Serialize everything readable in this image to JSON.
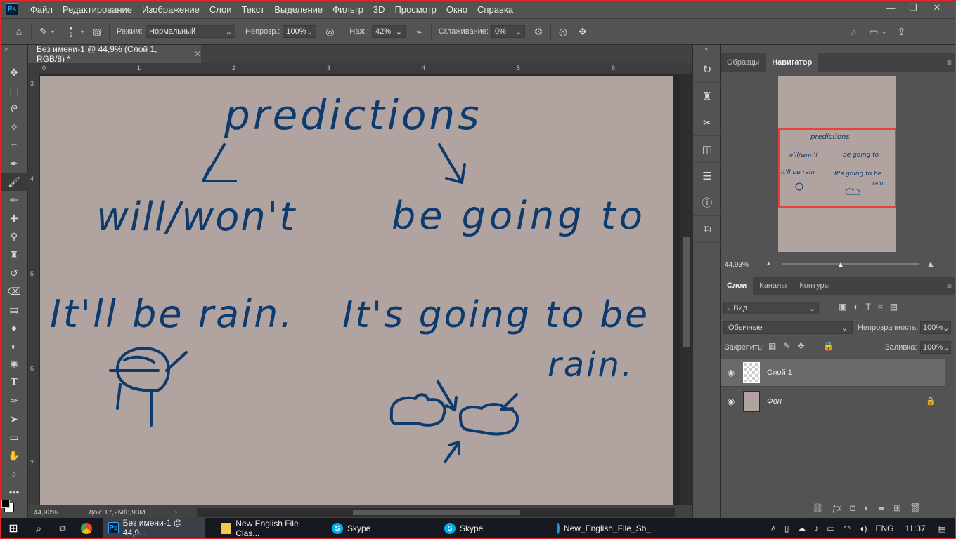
{
  "app": {
    "logo": "Ps",
    "menu": [
      "Файл",
      "Редактирование",
      "Изображение",
      "Слои",
      "Текст",
      "Выделение",
      "Фильтр",
      "3D",
      "Просмотр",
      "Окно",
      "Справка"
    ]
  },
  "options": {
    "brush_size": "9",
    "mode_label": "Режим:",
    "mode_value": "Нормальный",
    "opacity_label": "Непрозр.:",
    "opacity_value": "100%",
    "pressure_label": "Наж.:",
    "pressure_value": "42%",
    "smoothing_label": "Сглаживание:",
    "smoothing_value": "0%"
  },
  "document": {
    "tab_title": "Без имени-1 @ 44,9% (Слой 1, RGB/8) *",
    "ruler_h": [
      "0",
      "1",
      "2",
      "3",
      "4",
      "5",
      "6"
    ],
    "ruler_v": [
      "3",
      "4",
      "5",
      "6",
      "7"
    ],
    "zoom": "44,93%",
    "doc_info": "Док: 17,2M/8,93M",
    "canvas_text": {
      "title": "predictions",
      "left_head": "will/won't",
      "right_head": "be going to",
      "left_example": "It'll be rain.",
      "right_example_1": "It's going to be",
      "right_example_2": "rain."
    }
  },
  "navigator": {
    "tabs": [
      "Образцы",
      "Навигатор"
    ],
    "zoom": "44,93%"
  },
  "layers": {
    "tabs": [
      "Слои",
      "Каналы",
      "Контуры"
    ],
    "filter_label": "Вид",
    "blend_mode": "Обычные",
    "opacity_label": "Непрозрачность:",
    "opacity_value": "100%",
    "lock_label": "Закрепить:",
    "fill_label": "Заливка:",
    "fill_value": "100%",
    "items": [
      {
        "name": "Слой 1"
      },
      {
        "name": "Фон"
      }
    ]
  },
  "taskbar": {
    "apps": [
      {
        "label": "Без имени-1 @ 44,9..."
      },
      {
        "label": "New English File Clas..."
      },
      {
        "label": "Skype"
      },
      {
        "label": "Skype"
      },
      {
        "label": "New_English_File_Sb_..."
      }
    ],
    "lang": "ENG",
    "time": "11:37"
  },
  "colors": {
    "canvas": "#b1a39f",
    "ink": "#0d3b6e",
    "accent": "#e3242b"
  }
}
